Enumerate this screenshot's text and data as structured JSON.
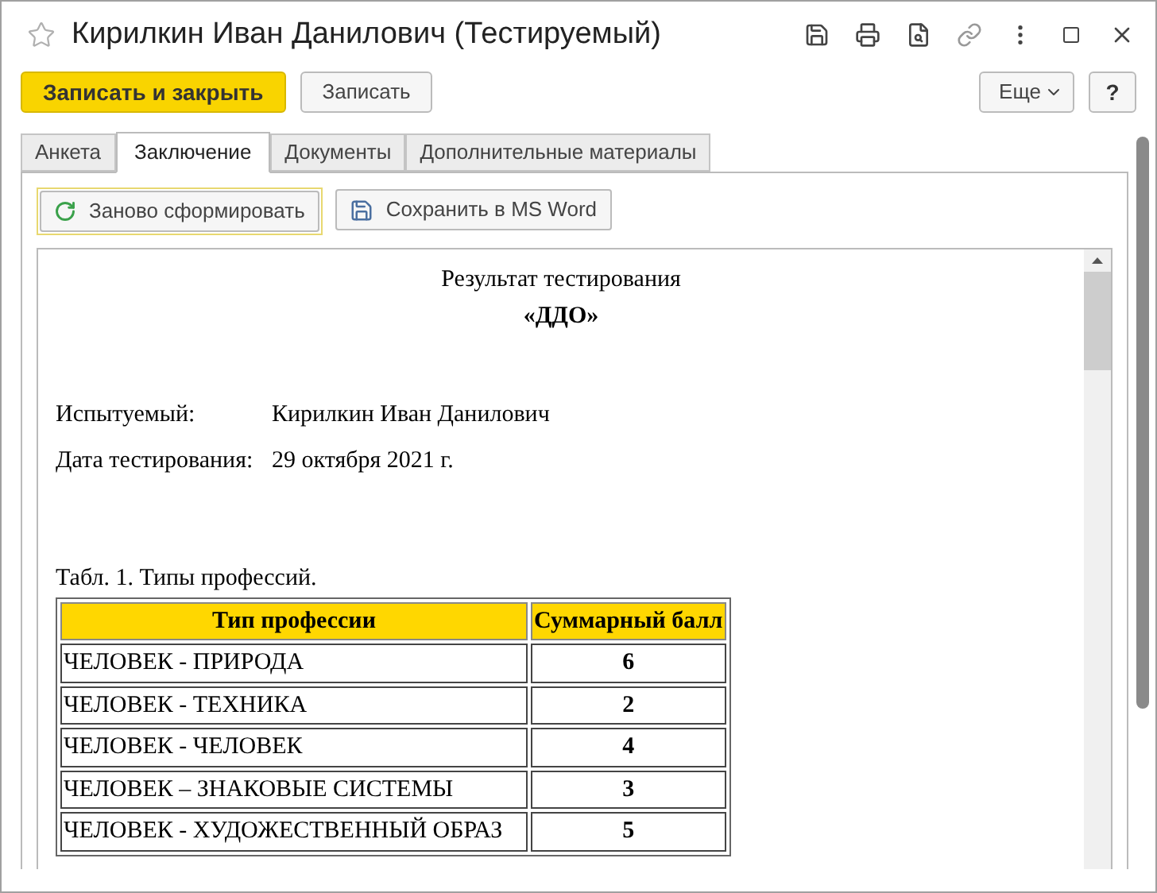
{
  "window": {
    "title": "Кирилкин Иван Данилович (Тестируемый)"
  },
  "command_bar": {
    "primary_button": "Записать и закрыть",
    "save_button": "Записать",
    "more_button": "Еще",
    "help_button": "?"
  },
  "tabs": [
    {
      "label": "Анкета",
      "selected": false
    },
    {
      "label": "Заключение",
      "selected": true
    },
    {
      "label": "Документы",
      "selected": false
    },
    {
      "label": "Дополнительные материалы",
      "selected": false
    }
  ],
  "toolbar": {
    "regenerate_button": "Заново сформировать",
    "export_button": "Сохранить в MS Word"
  },
  "document": {
    "title": "Результат тестирования",
    "subtitle": "«ДДО»",
    "fields": [
      {
        "label": "Испытуемый:",
        "value": "Кирилкин Иван Данилович"
      },
      {
        "label": "Дата тестирования:",
        "value": "29 октября 2021 г."
      }
    ],
    "table_caption": "Табл. 1. Типы профессий.",
    "table": {
      "columns": [
        "Тип профессии",
        "Суммарный балл"
      ],
      "rows": [
        [
          "ЧЕЛОВЕК - ПРИРОДА",
          "6"
        ],
        [
          "ЧЕЛОВЕК - ТЕХНИКА",
          "2"
        ],
        [
          "ЧЕЛОВЕК - ЧЕЛОВЕК",
          "4"
        ],
        [
          "ЧЕЛОВЕК – ЗНАКОВЫЕ СИСТЕМЫ",
          "3"
        ],
        [
          "ЧЕЛОВЕК - ХУДОЖЕСТВЕННЫЙ ОБРАЗ",
          "5"
        ]
      ]
    }
  }
}
